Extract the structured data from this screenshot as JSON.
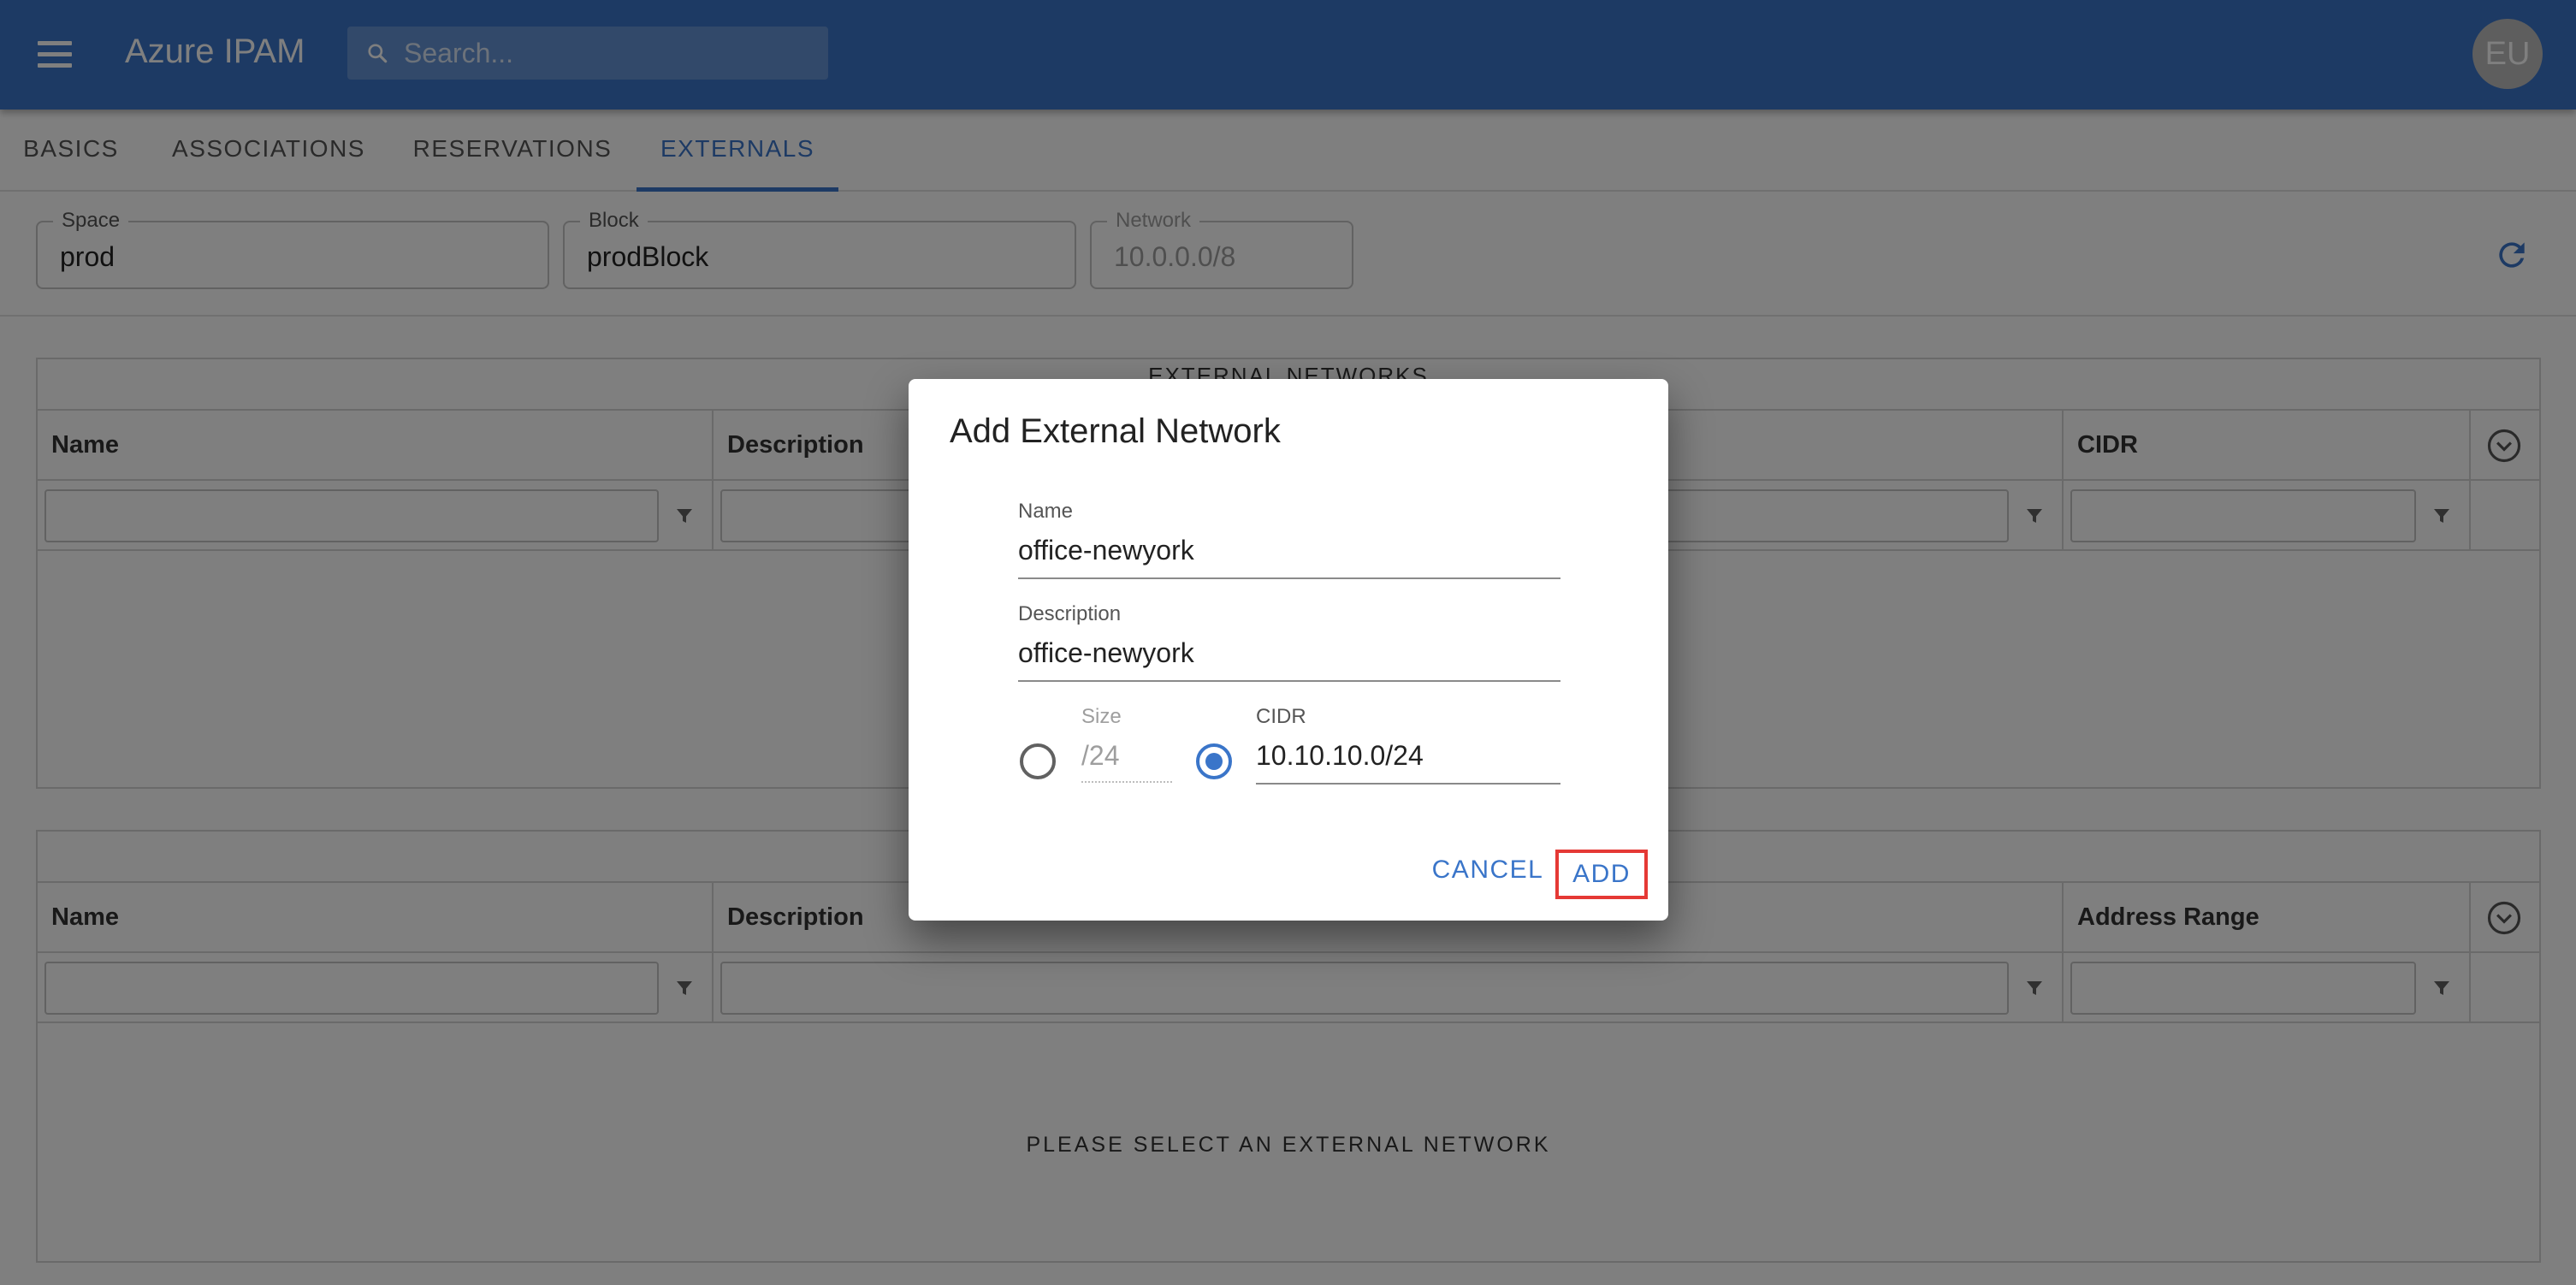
{
  "app": {
    "title": "Azure IPAM",
    "avatar_initials": "EU",
    "search": {
      "placeholder": "Search..."
    },
    "accent_color": "#3a75c9"
  },
  "tabs": [
    {
      "label": "BASICS",
      "active": false
    },
    {
      "label": "ASSOCIATIONS",
      "active": false
    },
    {
      "label": "RESERVATIONS",
      "active": false
    },
    {
      "label": "EXTERNALS",
      "active": true
    }
  ],
  "filters": {
    "space": {
      "label": "Space",
      "value": "prod"
    },
    "block": {
      "label": "Block",
      "value": "prodBlock"
    },
    "network": {
      "label": "Network",
      "value": "10.0.0.0/8",
      "disabled": true
    }
  },
  "externals_grid": {
    "title": "EXTERNAL NETWORKS",
    "columns": [
      "Name",
      "Description",
      "CIDR"
    ]
  },
  "subnets_grid": {
    "columns": [
      "Name",
      "Description",
      "Address Range"
    ],
    "empty_message": "PLEASE SELECT AN EXTERNAL NETWORK"
  },
  "dialog": {
    "title": "Add External Network",
    "name_label": "Name",
    "name_value": "office-newyork",
    "description_label": "Description",
    "description_value": "office-newyork",
    "size_label": "Size",
    "size_value": "/24",
    "cidr_label": "CIDR",
    "cidr_value": "10.10.10.0/24",
    "selected_option": "CIDR",
    "cancel_label": "CANCEL",
    "add_label": "ADD"
  }
}
